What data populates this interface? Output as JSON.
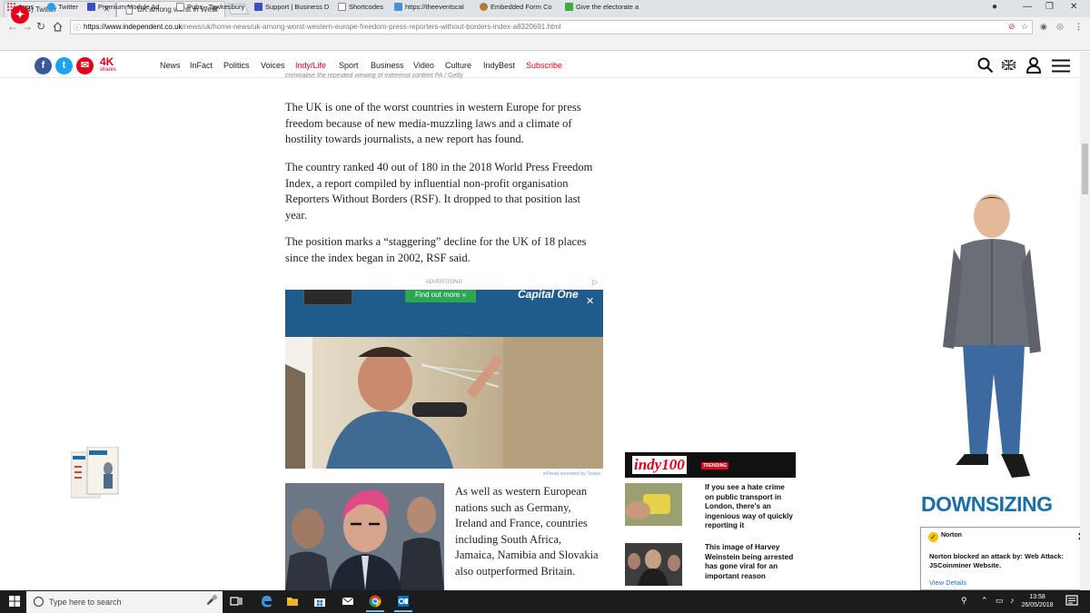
{
  "browser": {
    "tabs": [
      {
        "title": "(4) Twitter",
        "icon": "twitter-icon"
      },
      {
        "title": "UK among worst in West",
        "icon": "page-icon"
      }
    ],
    "url_host": "https://www.independent.co.uk",
    "url_rest": "/news/uk/home-news/uk-among-worst-western-europe-freedom-press-reporters-without-borders-index-a8320691.html",
    "bookmarks": [
      {
        "label": "Apps",
        "color": "#888888"
      },
      {
        "label": "Twitter",
        "color": "#1da1f2"
      },
      {
        "label": "Premium Module Ad",
        "color": "#3b4fbf"
      },
      {
        "label": "Pubs - Tewkesbury",
        "color": "#888888"
      },
      {
        "label": "Support | Business D",
        "color": "#3b4fbf"
      },
      {
        "label": "Shortcodes",
        "color": "#888888"
      },
      {
        "label": "https://theeventscal",
        "color": "#4a90d9"
      },
      {
        "label": "Embedded Form Co",
        "color": "#b07a3a"
      },
      {
        "label": "Give the electorate a",
        "color": "#3cae3c"
      }
    ]
  },
  "site": {
    "shares_count": "4K",
    "shares_label": "shares",
    "nav": [
      "News",
      "InFact",
      "Politics",
      "Voices",
      "Indy/Life",
      "Sport",
      "Business",
      "Video",
      "Culture",
      "IndyBest",
      "Subscribe"
    ]
  },
  "article": {
    "caption": "criminalise the repeated viewing of extremist content PA / Getty",
    "paragraphs": [
      "The UK is one of the worst countries in western Europe for press freedom because of new media-muzzling laws and a climate of hostility towards journalists, a new report has found.",
      "The country ranked 40 out of 180 in the 2018 World Press Freedom Index, a report compiled by influential non-profit organisation Reporters Without Borders (RSF). It dropped to that position last year.",
      "The position marks a “staggering” decline for the UK of 18 places since the index began in 2002, RSF said."
    ],
    "side_paragraph": "As well as western European nations such as Germany, Ireland and France, countries including South Africa, Jamaica, Namibia and Slovakia also outperformed Britain."
  },
  "ad": {
    "label": "ADVERTISING",
    "cta": "Find out more »",
    "brand": "Capital One",
    "footer": "inRead invented by Teads"
  },
  "indy100": {
    "logo": "indy100",
    "badge": "TRENDING",
    "stories": [
      "If you see a hate crime on public transport in London, there's an ingenious way of quickly reporting it",
      "This image of Harvey Weinstein being arrested has gone viral for an important reason"
    ]
  },
  "side_ad": {
    "title": "DOWNSIZING"
  },
  "norton": {
    "brand": "Norton",
    "message": "Norton blocked an attack by: Web Attack: JSCoinminer Website.",
    "link": "View Details"
  },
  "taskbar": {
    "search_placeholder": "Type here to search",
    "time": "13:58",
    "date": "26/05/2018"
  }
}
